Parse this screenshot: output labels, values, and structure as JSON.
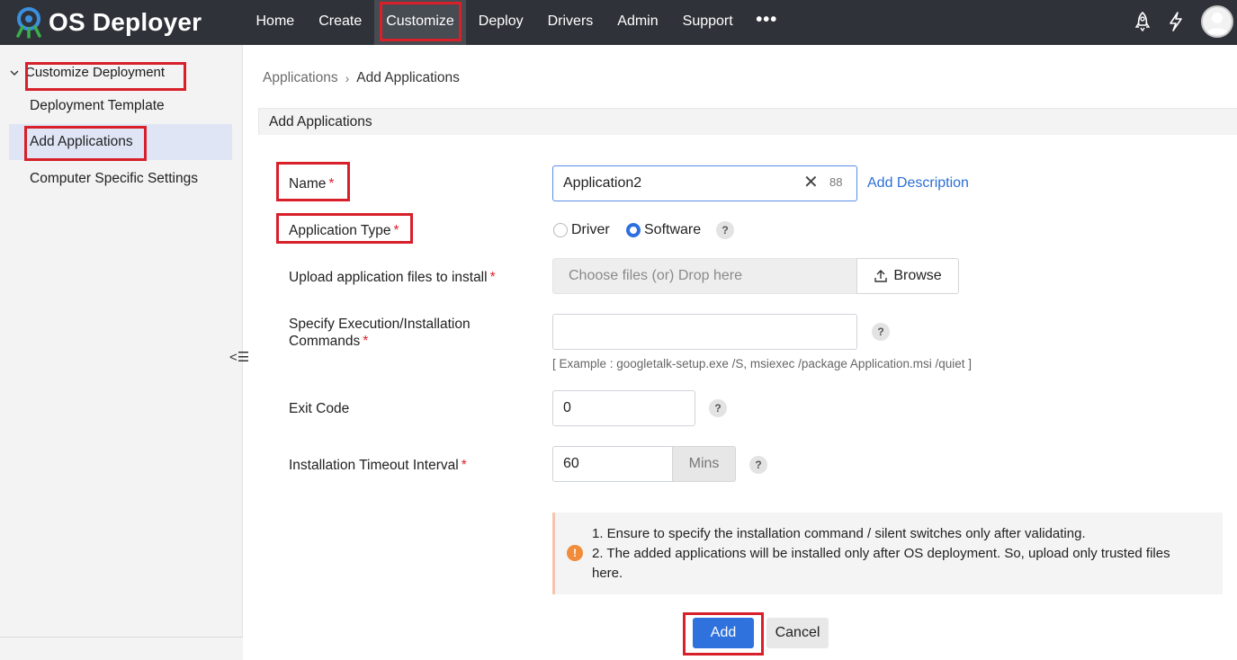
{
  "app": {
    "title": "OS Deployer"
  },
  "nav": {
    "items": [
      {
        "label": "Home"
      },
      {
        "label": "Create"
      },
      {
        "label": "Customize"
      },
      {
        "label": "Deploy"
      },
      {
        "label": "Drivers"
      },
      {
        "label": "Admin"
      },
      {
        "label": "Support"
      }
    ],
    "more_label": "•••",
    "active": "Customize",
    "icons": [
      "rocket-icon",
      "lightning-icon",
      "user-avatar"
    ]
  },
  "sidebar": {
    "group_label": "Customize Deployment",
    "items": [
      {
        "label": "Deployment Template"
      },
      {
        "label": "Add Applications"
      },
      {
        "label": "Computer Specific Settings"
      }
    ],
    "active_item": "Add Applications",
    "collapse_glyph": "<☰"
  },
  "breadcrumb": {
    "parent": "Applications",
    "separator": "›",
    "current": "Add Applications"
  },
  "section": {
    "title": "Add Applications"
  },
  "form": {
    "name": {
      "label": "Name",
      "required_mark": "*",
      "value": "Application2",
      "char_count": "88",
      "add_description": "Add Description"
    },
    "app_type": {
      "label": "Application Type",
      "required_mark": "*",
      "options": [
        "Driver",
        "Software"
      ],
      "selected": "Software",
      "help": "?"
    },
    "upload": {
      "label": "Upload application files to install",
      "required_mark": "*",
      "placeholder": "Choose files (or) Drop here",
      "browse_label": "Browse"
    },
    "commands": {
      "label_line1": "Specify Execution/Installation",
      "label_line2": "Commands",
      "required_mark": "*",
      "value": "",
      "help": "?",
      "hint": "[ Example : googletalk-setup.exe /S, msiexec /package Application.msi /quiet ]"
    },
    "exit_code": {
      "label": "Exit Code",
      "value": "0",
      "help": "?"
    },
    "timeout": {
      "label": "Installation Timeout Interval",
      "required_mark": "*",
      "value": "60",
      "unit": "Mins",
      "help": "?"
    }
  },
  "notice": {
    "icon": "!",
    "line1": "1. Ensure to specify the installation command / silent switches only after validating.",
    "line2": "2. The added applications will be installed only after OS deployment. So, upload only trusted files here."
  },
  "buttons": {
    "add": "Add",
    "cancel": "Cancel"
  },
  "colors": {
    "topbar": "#2f3339",
    "accent": "#2f72de",
    "highlight_box": "#d7202a",
    "required": "#e0202a",
    "link": "#2d6fd6"
  }
}
